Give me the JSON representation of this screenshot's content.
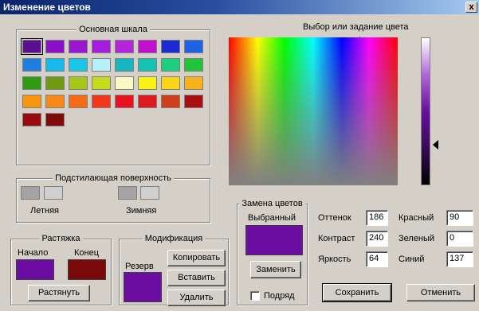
{
  "window": {
    "title": "Изменение цветов",
    "close_glyph": "x"
  },
  "basic": {
    "label": "Основная шкала",
    "swatches": [
      "#5b0f8e",
      "#8a10c7",
      "#9a15cf",
      "#a51ee0",
      "#b426dd",
      "#c20fcf",
      "#1c2ad1",
      "#1e62e6",
      "#1e7fe0",
      "#17b9ea",
      "#1ac6e6",
      "#b7f0fa",
      "#14b7c0",
      "#14c3b2",
      "#1ad07e",
      "#21c53a",
      "#2f9a12",
      "#6f9a12",
      "#a6c61a",
      "#c5dc1a",
      "#fcf9c4",
      "#f8f216",
      "#f8d516",
      "#f9b31a",
      "#f89410",
      "#f88a1c",
      "#f56c14",
      "#f1361c",
      "#e8131f",
      "#dc1a20",
      "#ce3f1a",
      "#a80f12",
      "#9a0a0e",
      "#7e0b0b"
    ]
  },
  "spectrum": {
    "label": "Выбор или задание цвета"
  },
  "surface": {
    "label": "Подстилающая поверхность",
    "summer_label": "Летняя",
    "winter_label": "Зимняя",
    "summer_colors": [
      "#a3a3a3",
      "#cfcfcf"
    ],
    "winter_colors": [
      "#a3a3a3",
      "#cfcfcf"
    ]
  },
  "stretch": {
    "label": "Растяжка",
    "start_label": "Начало",
    "end_label": "Конец",
    "start_color": "#6a0da0",
    "end_color": "#7a0a0a",
    "stretch_button": "Растянуть"
  },
  "modify": {
    "label": "Модификация",
    "reserve_label": "Резерв",
    "reserve_color": "#6a0da0",
    "copy_button": "Копировать",
    "paste_button": "Вставить",
    "delete_button": "Удалить"
  },
  "replace": {
    "label": "Замена цветов",
    "selected_label": "Выбранный",
    "selected_color": "#6a0da0",
    "replace_button": "Заменить",
    "row_label": "Подряд",
    "row_checked": false
  },
  "values": {
    "hue_label": "Оттенок",
    "hue": "186",
    "contrast_label": "Контраст",
    "contrast": "240",
    "brightness_label": "Яркость",
    "brightness": "64",
    "red_label": "Красный",
    "red": "90",
    "green_label": "Зеленый",
    "green": "0",
    "blue_label": "Синий",
    "blue": "137"
  },
  "footer": {
    "save_button": "Сохранить",
    "cancel_button": "Отменить"
  }
}
